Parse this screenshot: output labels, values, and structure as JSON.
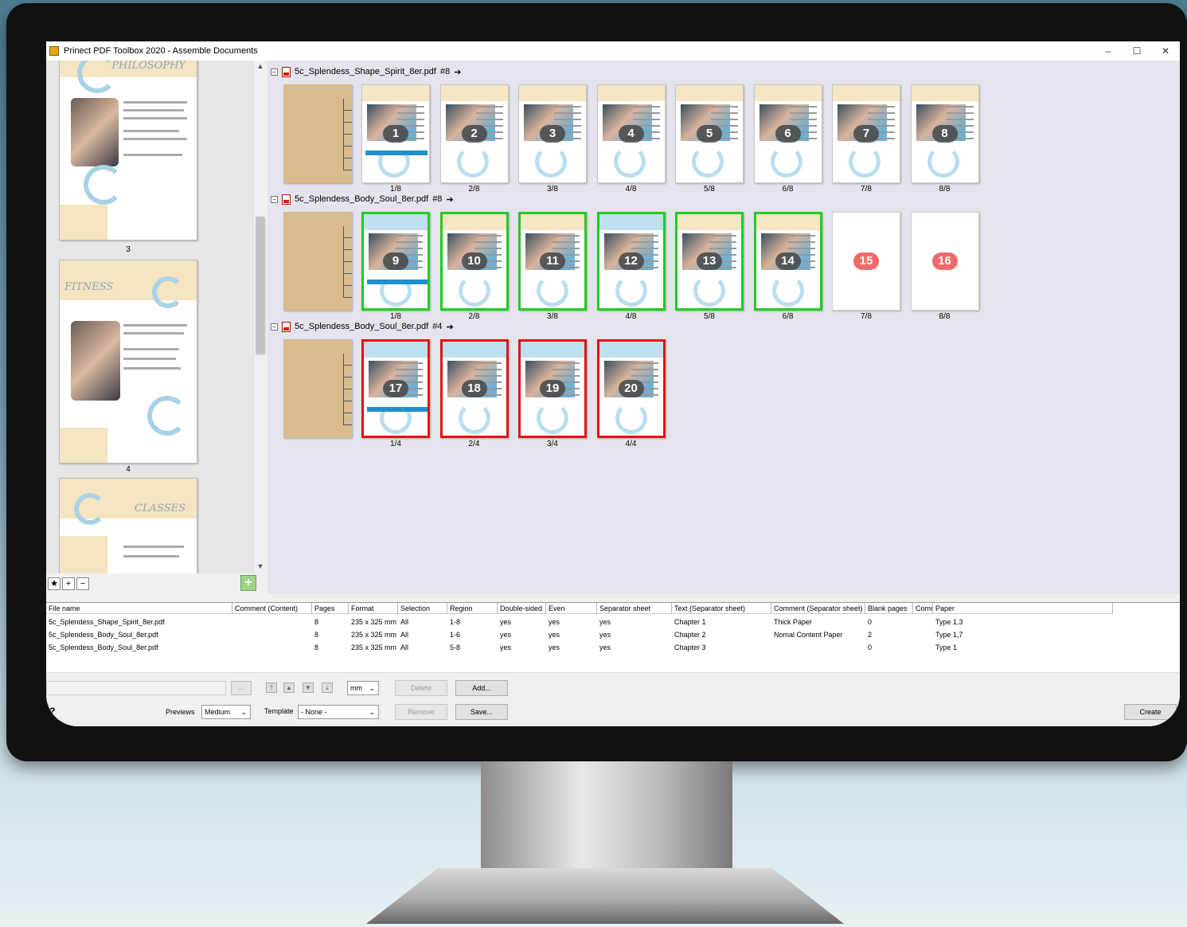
{
  "window": {
    "title": "Prinect PDF Toolbox 2020 - Assemble Documents",
    "min": "–",
    "max": "☐",
    "close": "✕"
  },
  "left_pane": {
    "pages": [
      {
        "heading": "PHILOSOPHY",
        "number": "3"
      },
      {
        "heading": "FITNESS",
        "number": "4"
      },
      {
        "heading": "CLASSES",
        "number": ""
      }
    ],
    "toolbar": {
      "star": "★",
      "plus": "+",
      "minus": "−",
      "add": "+"
    }
  },
  "documents": [
    {
      "filename": "5c_Splendess_Shape_Spirit_8er.pdf",
      "count": "#8",
      "pages": [
        {
          "badge": "1",
          "label": "1/8",
          "state": "normal"
        },
        {
          "badge": "2",
          "label": "2/8",
          "state": "normal"
        },
        {
          "badge": "3",
          "label": "3/8",
          "state": "normal"
        },
        {
          "badge": "4",
          "label": "4/8",
          "state": "normal"
        },
        {
          "badge": "5",
          "label": "5/8",
          "state": "normal"
        },
        {
          "badge": "6",
          "label": "6/8",
          "state": "normal"
        },
        {
          "badge": "7",
          "label": "7/8",
          "state": "normal"
        },
        {
          "badge": "8",
          "label": "8/8",
          "state": "normal"
        }
      ]
    },
    {
      "filename": "5c_Splendess_Body_Soul_8er.pdf",
      "count": "#8",
      "pages": [
        {
          "badge": "9",
          "label": "1/8",
          "state": "green"
        },
        {
          "badge": "10",
          "label": "2/8",
          "state": "green"
        },
        {
          "badge": "11",
          "label": "3/8",
          "state": "green"
        },
        {
          "badge": "12",
          "label": "4/8",
          "state": "green"
        },
        {
          "badge": "13",
          "label": "5/8",
          "state": "green"
        },
        {
          "badge": "14",
          "label": "6/8",
          "state": "green"
        },
        {
          "badge": "15",
          "label": "7/8",
          "state": "blank"
        },
        {
          "badge": "16",
          "label": "8/8",
          "state": "blank"
        }
      ]
    },
    {
      "filename": "5c_Splendess_Body_Soul_8er.pdf",
      "count": "#4",
      "pages": [
        {
          "badge": "17",
          "label": "1/4",
          "state": "red"
        },
        {
          "badge": "18",
          "label": "2/4",
          "state": "red"
        },
        {
          "badge": "19",
          "label": "3/4",
          "state": "red"
        },
        {
          "badge": "20",
          "label": "4/4",
          "state": "red"
        }
      ]
    }
  ],
  "table": {
    "headers": [
      "File name",
      "Comment (Content)",
      "Pages",
      "Format",
      "Selection",
      "Region",
      "Double-sided",
      "Even",
      "Separator sheet",
      "Text (Separator sheet)",
      "Comment (Separator sheet)",
      "Blank pages",
      "Comm",
      "Paper"
    ],
    "rows": [
      [
        "5c_Splendess_Shape_Spirit_8er.pdf",
        "",
        "8",
        "235 x 325 mm",
        "All",
        "1-8",
        "yes",
        "yes",
        "yes",
        "Chapter 1",
        "Thick Paper",
        "0",
        "",
        "Type 1,3"
      ],
      [
        "5c_Splendess_Body_Soul_8er.pdf",
        "",
        "8",
        "235 x 325 mm",
        "All",
        "1-6",
        "yes",
        "yes",
        "yes",
        "Chapter 2",
        "Nomal Content Paper",
        "2",
        "",
        "Type 1,7"
      ],
      [
        "5c_Splendess_Body_Soul_8er.pdf",
        "",
        "8",
        "235 x 325 mm",
        "All",
        "5-8",
        "yes",
        "yes",
        "yes",
        "Chapter 3",
        "",
        "0",
        "",
        "Type 1"
      ]
    ]
  },
  "bottom": {
    "browse": "...",
    "unit": "mm",
    "delete": "Delete",
    "add": "Add...",
    "remove": "Remove",
    "save": "Save...",
    "previews_label": "Previews",
    "previews_value": "Medium",
    "template_label": "Template",
    "template_value": "- None -",
    "create": "Create",
    "help": "?"
  }
}
